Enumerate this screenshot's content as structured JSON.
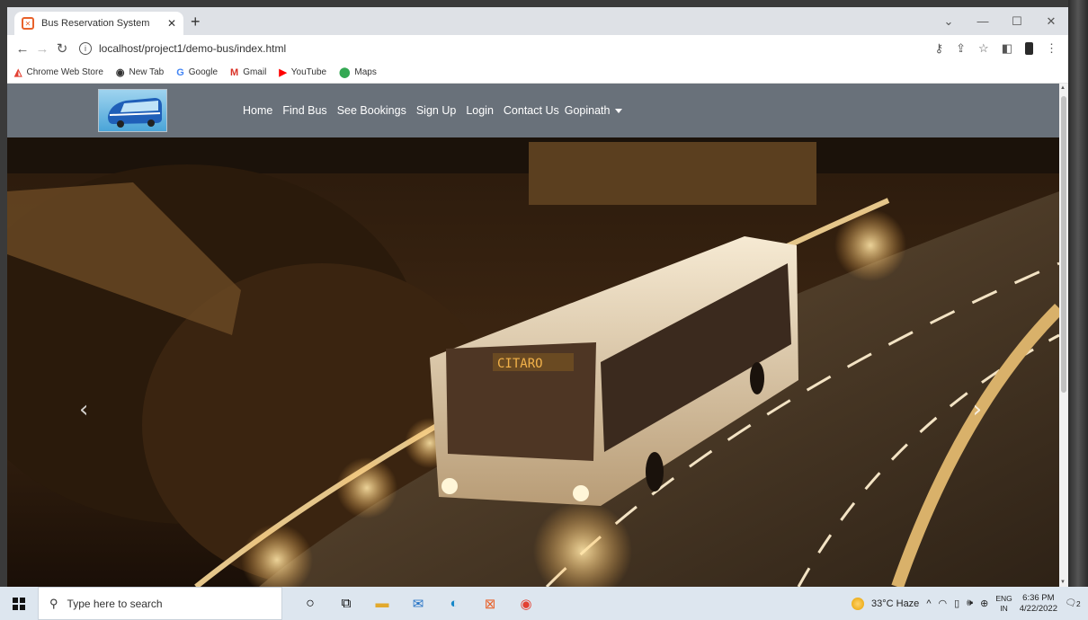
{
  "browser": {
    "tab_title": "Bus Reservation System",
    "tab_close": "✕",
    "new_tab": "+",
    "url": "localhost/project1/demo-bus/index.html",
    "window_controls": [
      "⌄",
      "—",
      "☐",
      "✕"
    ]
  },
  "bookmarks": [
    {
      "label": "Chrome Web Store",
      "icon": "chrome-web-store-icon",
      "glyph": "◭",
      "color": "#e34133"
    },
    {
      "label": "New Tab",
      "icon": "globe-icon",
      "glyph": "◉",
      "color": "#333333"
    },
    {
      "label": "Google",
      "icon": "google-icon",
      "glyph": "G",
      "color": "#4285f4"
    },
    {
      "label": "Gmail",
      "icon": "gmail-icon",
      "glyph": "M",
      "color": "#d93025"
    },
    {
      "label": "YouTube",
      "icon": "youtube-icon",
      "glyph": "▶",
      "color": "#ff0000"
    },
    {
      "label": "Maps",
      "icon": "maps-pin-icon",
      "glyph": "⬤",
      "color": "#34a853"
    }
  ],
  "site": {
    "nav": [
      "Home",
      "Find Bus",
      "See Bookings",
      "Sign Up",
      "Login",
      "Contact Us"
    ],
    "user": "Gopinath",
    "carousel_prev": "‹",
    "carousel_next": "›",
    "bus_sign": "CITARO"
  },
  "taskbar": {
    "search_placeholder": "Type here to search",
    "weather": "33°C Haze",
    "lang_top": "ENG",
    "lang_bottom": "IN",
    "time": "6:36 PM",
    "date": "4/22/2022",
    "notifications": "2"
  },
  "colors": {
    "navbar": "#69717a",
    "tabbar": "#dee1e6",
    "taskbar": "#dde6ef"
  }
}
